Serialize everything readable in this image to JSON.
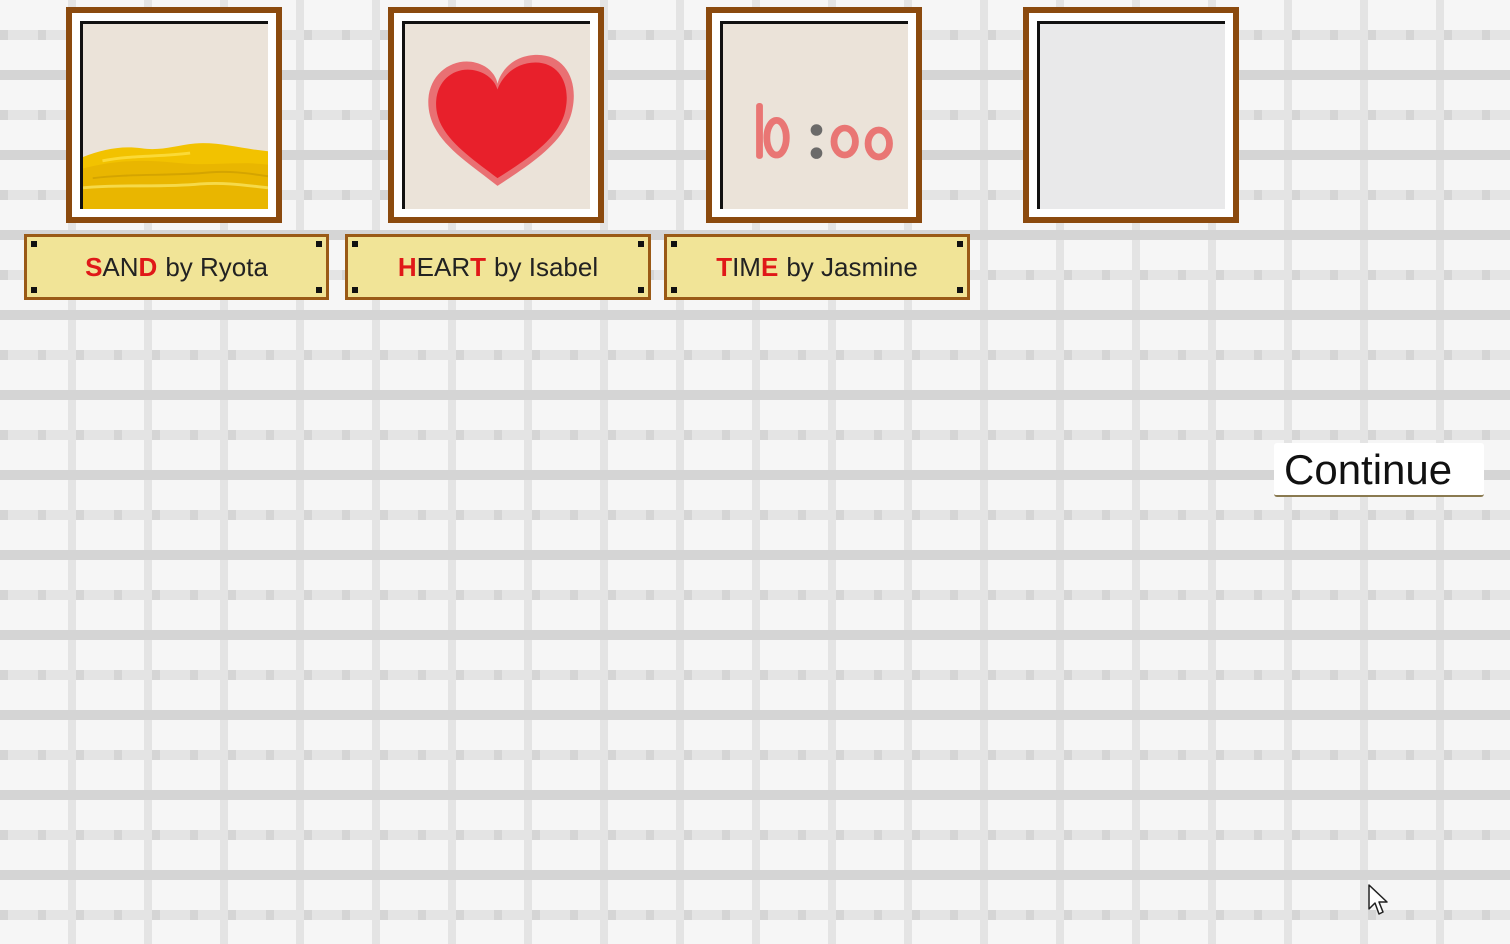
{
  "paintings": [
    {
      "id": "sand",
      "title_first": "S",
      "title_middle": "AN",
      "title_last": "D",
      "artist_text": "by Ryota",
      "icon": "sand-painting"
    },
    {
      "id": "heart",
      "title_first": "H",
      "title_middle": "EAR",
      "title_last": "T",
      "artist_text": "by Isabel",
      "icon": "heart-painting"
    },
    {
      "id": "time",
      "title_first": "T",
      "title_middle": "IM",
      "title_last": "E",
      "artist_text": "by Jasmine",
      "icon": "clock-painting",
      "painting_text": "10:00"
    }
  ],
  "empty_frame": {
    "icon": "empty-canvas"
  },
  "continue_button": {
    "label": "Continue"
  },
  "colors": {
    "frame": "#8b4a0e",
    "plaque": "#f1e497",
    "highlight_letter": "#e01818"
  }
}
